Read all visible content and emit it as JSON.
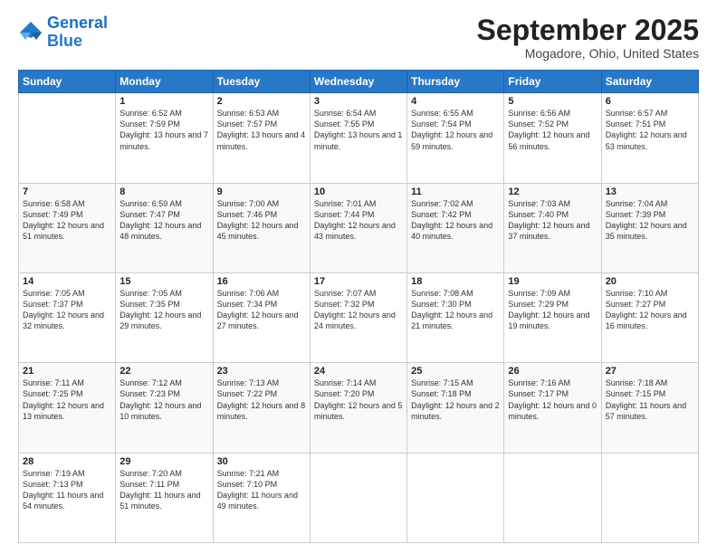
{
  "logo": {
    "line1": "General",
    "line2": "Blue"
  },
  "title": "September 2025",
  "subtitle": "Mogadore, Ohio, United States",
  "days_header": [
    "Sunday",
    "Monday",
    "Tuesday",
    "Wednesday",
    "Thursday",
    "Friday",
    "Saturday"
  ],
  "weeks": [
    [
      {
        "num": "",
        "info": ""
      },
      {
        "num": "1",
        "info": "Sunrise: 6:52 AM\nSunset: 7:59 PM\nDaylight: 13 hours\nand 7 minutes."
      },
      {
        "num": "2",
        "info": "Sunrise: 6:53 AM\nSunset: 7:57 PM\nDaylight: 13 hours\nand 4 minutes."
      },
      {
        "num": "3",
        "info": "Sunrise: 6:54 AM\nSunset: 7:55 PM\nDaylight: 13 hours\nand 1 minute."
      },
      {
        "num": "4",
        "info": "Sunrise: 6:55 AM\nSunset: 7:54 PM\nDaylight: 12 hours\nand 59 minutes."
      },
      {
        "num": "5",
        "info": "Sunrise: 6:56 AM\nSunset: 7:52 PM\nDaylight: 12 hours\nand 56 minutes."
      },
      {
        "num": "6",
        "info": "Sunrise: 6:57 AM\nSunset: 7:51 PM\nDaylight: 12 hours\nand 53 minutes."
      }
    ],
    [
      {
        "num": "7",
        "info": "Sunrise: 6:58 AM\nSunset: 7:49 PM\nDaylight: 12 hours\nand 51 minutes."
      },
      {
        "num": "8",
        "info": "Sunrise: 6:59 AM\nSunset: 7:47 PM\nDaylight: 12 hours\nand 48 minutes."
      },
      {
        "num": "9",
        "info": "Sunrise: 7:00 AM\nSunset: 7:46 PM\nDaylight: 12 hours\nand 45 minutes."
      },
      {
        "num": "10",
        "info": "Sunrise: 7:01 AM\nSunset: 7:44 PM\nDaylight: 12 hours\nand 43 minutes."
      },
      {
        "num": "11",
        "info": "Sunrise: 7:02 AM\nSunset: 7:42 PM\nDaylight: 12 hours\nand 40 minutes."
      },
      {
        "num": "12",
        "info": "Sunrise: 7:03 AM\nSunset: 7:40 PM\nDaylight: 12 hours\nand 37 minutes."
      },
      {
        "num": "13",
        "info": "Sunrise: 7:04 AM\nSunset: 7:39 PM\nDaylight: 12 hours\nand 35 minutes."
      }
    ],
    [
      {
        "num": "14",
        "info": "Sunrise: 7:05 AM\nSunset: 7:37 PM\nDaylight: 12 hours\nand 32 minutes."
      },
      {
        "num": "15",
        "info": "Sunrise: 7:05 AM\nSunset: 7:35 PM\nDaylight: 12 hours\nand 29 minutes."
      },
      {
        "num": "16",
        "info": "Sunrise: 7:06 AM\nSunset: 7:34 PM\nDaylight: 12 hours\nand 27 minutes."
      },
      {
        "num": "17",
        "info": "Sunrise: 7:07 AM\nSunset: 7:32 PM\nDaylight: 12 hours\nand 24 minutes."
      },
      {
        "num": "18",
        "info": "Sunrise: 7:08 AM\nSunset: 7:30 PM\nDaylight: 12 hours\nand 21 minutes."
      },
      {
        "num": "19",
        "info": "Sunrise: 7:09 AM\nSunset: 7:29 PM\nDaylight: 12 hours\nand 19 minutes."
      },
      {
        "num": "20",
        "info": "Sunrise: 7:10 AM\nSunset: 7:27 PM\nDaylight: 12 hours\nand 16 minutes."
      }
    ],
    [
      {
        "num": "21",
        "info": "Sunrise: 7:11 AM\nSunset: 7:25 PM\nDaylight: 12 hours\nand 13 minutes."
      },
      {
        "num": "22",
        "info": "Sunrise: 7:12 AM\nSunset: 7:23 PM\nDaylight: 12 hours\nand 10 minutes."
      },
      {
        "num": "23",
        "info": "Sunrise: 7:13 AM\nSunset: 7:22 PM\nDaylight: 12 hours\nand 8 minutes."
      },
      {
        "num": "24",
        "info": "Sunrise: 7:14 AM\nSunset: 7:20 PM\nDaylight: 12 hours\nand 5 minutes."
      },
      {
        "num": "25",
        "info": "Sunrise: 7:15 AM\nSunset: 7:18 PM\nDaylight: 12 hours\nand 2 minutes."
      },
      {
        "num": "26",
        "info": "Sunrise: 7:16 AM\nSunset: 7:17 PM\nDaylight: 12 hours\nand 0 minutes."
      },
      {
        "num": "27",
        "info": "Sunrise: 7:18 AM\nSunset: 7:15 PM\nDaylight: 11 hours\nand 57 minutes."
      }
    ],
    [
      {
        "num": "28",
        "info": "Sunrise: 7:19 AM\nSunset: 7:13 PM\nDaylight: 11 hours\nand 54 minutes."
      },
      {
        "num": "29",
        "info": "Sunrise: 7:20 AM\nSunset: 7:11 PM\nDaylight: 11 hours\nand 51 minutes."
      },
      {
        "num": "30",
        "info": "Sunrise: 7:21 AM\nSunset: 7:10 PM\nDaylight: 11 hours\nand 49 minutes."
      },
      {
        "num": "",
        "info": ""
      },
      {
        "num": "",
        "info": ""
      },
      {
        "num": "",
        "info": ""
      },
      {
        "num": "",
        "info": ""
      }
    ]
  ]
}
